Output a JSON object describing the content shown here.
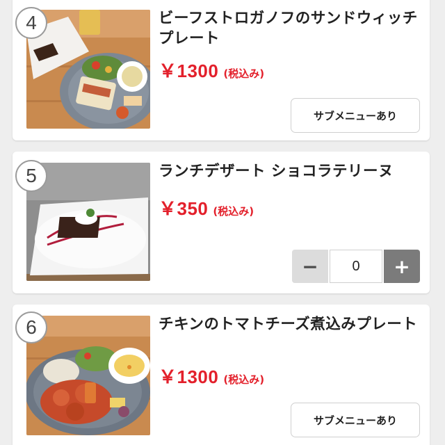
{
  "items": [
    {
      "number": "4",
      "title": "ビーフストロガノフのサンドウィッチプレート",
      "price": "￥1300",
      "tax_note": "(税込み)",
      "submenu_label": "サブメニューあり"
    },
    {
      "number": "5",
      "title": "ランチデザート ショコラテリーヌ",
      "price": "￥350",
      "tax_note": "(税込み)",
      "quantity": "0",
      "minus_label": "−",
      "plus_label": "+"
    },
    {
      "number": "6",
      "title": "チキンのトマトチーズ煮込みプレート",
      "price": "￥1300",
      "tax_note": "(税込み)",
      "submenu_label": "サブメニューあり"
    }
  ],
  "colors": {
    "price": "#e3202b",
    "background": "#eeeeee",
    "card": "#ffffff"
  }
}
